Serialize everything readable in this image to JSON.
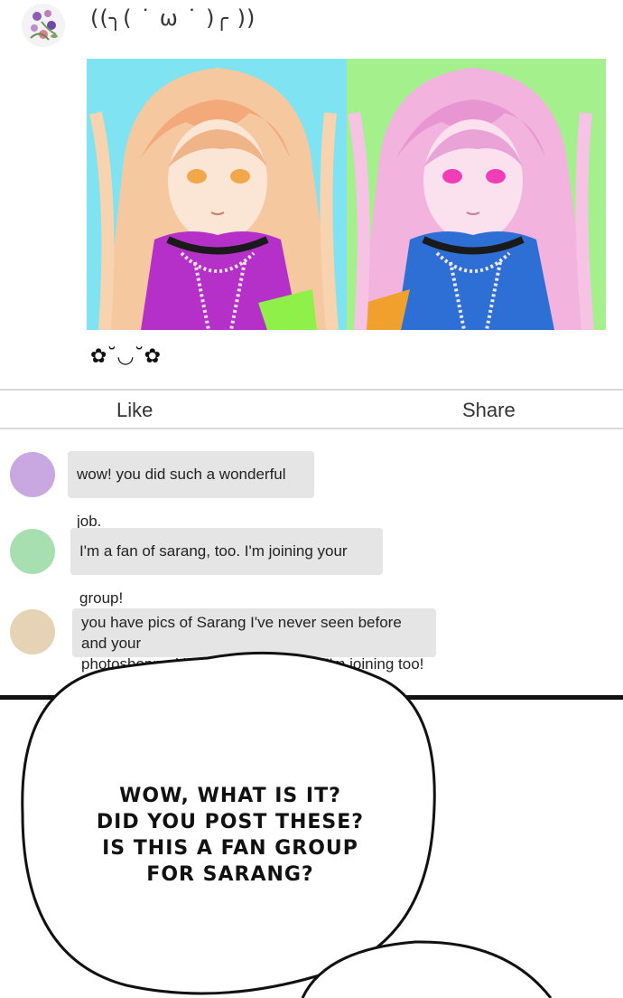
{
  "post": {
    "caption": "((╮( ˙ ω ˙ )╭ ))",
    "emote": "✿˘◡˘✿",
    "colors": {
      "left_bg": "#7fe3f1",
      "right_bg": "#a4f08c",
      "left_jacket": "#b530c9",
      "right_jacket": "#2e6fd6"
    }
  },
  "actions": {
    "like": "Like",
    "share": "Share"
  },
  "comments": [
    {
      "text": "wow! you did such a wonderful job.",
      "avatar_color": "#c9a8e2"
    },
    {
      "text": "I'm a fan of sarang, too. I'm joining your group!",
      "avatar_color": "#a8dfb0"
    },
    {
      "text_line1": "you have pics of Sarang I've never seen before and your",
      "text_line2": "photoshopped images are cool too! I'm joining too!",
      "avatar_color": "#e6d3b5"
    }
  ],
  "speech": {
    "line1": "WOW, WHAT IS IT?",
    "line2": "DID YOU POST THESE?",
    "line3": "IS THIS A FAN GROUP",
    "line4": "FOR SARANG?"
  }
}
